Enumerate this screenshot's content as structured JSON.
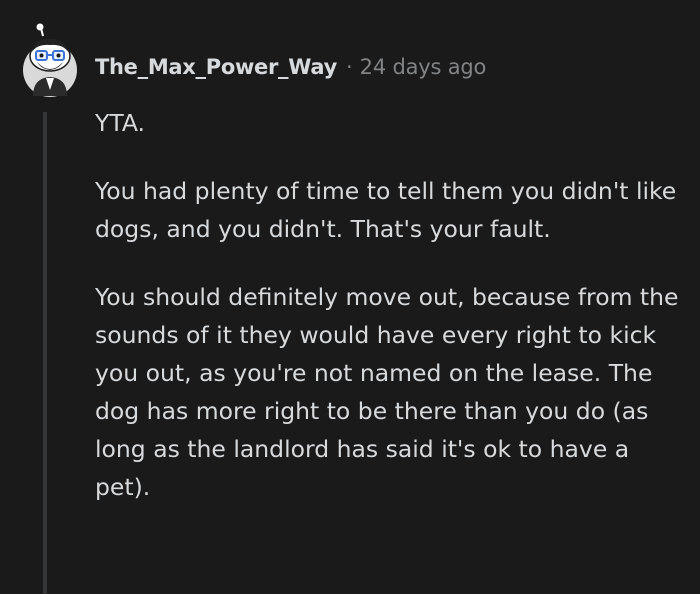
{
  "comment": {
    "author": "The_Max_Power_Way",
    "separator": "·",
    "timestamp": "24 days ago",
    "avatar_icon": "snoo-avatar-icon",
    "paragraphs": [
      "YTA.",
      "You had plenty of time to tell them you didn't like dogs, and you didn't. That's your fault.",
      "You should definitely move out, because from the sounds of it they would have every right to kick you out, as you're not named on the lease. The dog has more right to be there than you do (as long as the landlord has said it's ok to have a pet)."
    ]
  },
  "colors": {
    "background": "#1a1a1b",
    "text": "#d7dadc",
    "meta": "#818384",
    "thread_line": "#343536",
    "avatar_accent": "#3b74d6"
  }
}
